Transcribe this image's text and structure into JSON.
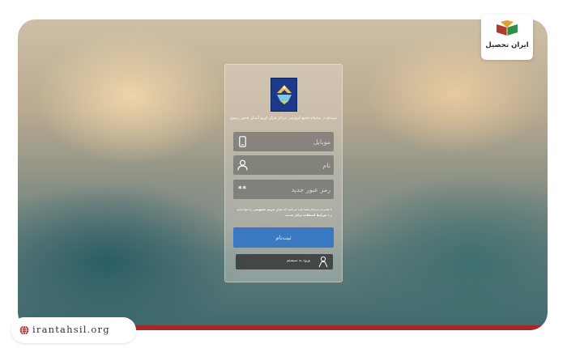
{
  "panel": {
    "title": "ثبت‌نام در سامانه جامع آموزشی مراکز قرآن کریم آستان قدس رضوی",
    "mobile_placeholder": "موبایل",
    "name_placeholder": "نام",
    "password_placeholder": "رمز عبور جدید",
    "password_icon_text": "**",
    "terms": {
      "part1": "با فشردن ثبت‌نام شما تایید می‌کنید که بخش ",
      "privacy": "حریم خصوصی",
      "part2": " را خوانده‌اید و با ",
      "conditions": "شرایط استفاده",
      "part3": " موافق هستید."
    },
    "register_label": "ثبت‌نام",
    "login_label": "ورود به سیستم"
  },
  "brand": {
    "name": "ایران تحصیل"
  },
  "site": {
    "url": "irantahsil.org"
  },
  "colors": {
    "accent_red": "#a8262b",
    "register_blue": "#3a78c2"
  }
}
